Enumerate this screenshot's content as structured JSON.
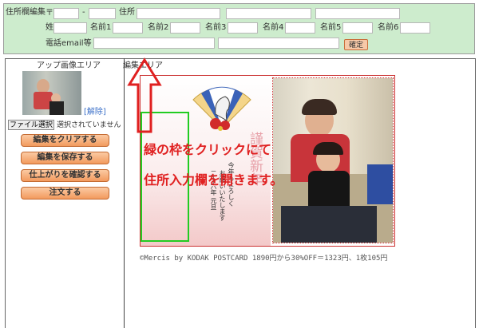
{
  "address_panel": {
    "title": "住所欄編集",
    "zip_mark": "〒",
    "zip_separator": "-",
    "address_label": "住所",
    "surname_label": "姓",
    "given_name_labels": [
      "名前1",
      "名前2",
      "名前3",
      "名前4",
      "名前5",
      "名前6"
    ],
    "contact_label": "電話email等",
    "confirm_label": "確定"
  },
  "upload_area": {
    "label": "アップ画像エリア",
    "remove_link": "[解除]",
    "file_button": "ファイル選択",
    "file_status": "選択されていません"
  },
  "actions": {
    "clear": "編集をクリアする",
    "save": "編集を保存する",
    "preview": "仕上がりを確認する",
    "order": "注文する"
  },
  "edit_area": {
    "label": "編集エリア",
    "annotation_line1": "緑の枠をクリックにて",
    "annotation_line2": "住所入力欄を開きます。",
    "card_greeting": "謹賀新年",
    "card_message_1": "今年もよろしく",
    "card_message_2": "お願いいたします",
    "card_date": "二十六年 元旦",
    "caption": "©Mercis by KODAK POSTCARD 1890円から30%OFF＝1323円、1枚105円"
  },
  "colors": {
    "panel_bg": "#cdeccd",
    "orange_button": "#f29a5e",
    "annotation_red": "#e02020",
    "green_frame": "#22cc22"
  }
}
